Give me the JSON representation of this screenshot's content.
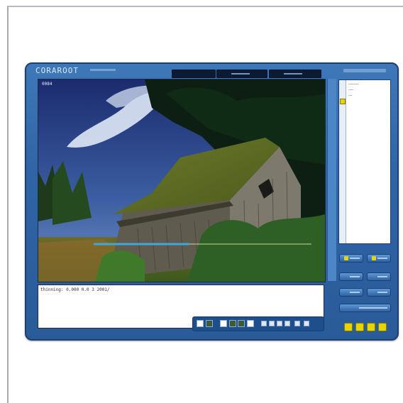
{
  "app": {
    "logo_text": "CORAROOT",
    "image_label": "0084"
  },
  "image": {
    "description_icon": "photo-preview"
  },
  "text_area": {
    "line": "thinning: 0.000 0.0 3 2001/"
  },
  "side_panel": {
    "items": [
      "--------",
      "----",
      "---"
    ]
  },
  "colors": {
    "frame": "#2f64a6",
    "frame_dark": "#1d3f72",
    "accent_yellow": "#e8d400",
    "selection_line": "#3fa7d9"
  },
  "icons": {
    "toolbar": [
      "white-square-icon",
      "photo-thumb-icon",
      "white-square-icon",
      "photo-thumb-icon",
      "photo-thumb-icon",
      "white-square-icon",
      "arrow-icon",
      "grid-icon",
      "grid-icon",
      "grid-icon",
      "zoom-icon",
      "pen-icon"
    ]
  }
}
